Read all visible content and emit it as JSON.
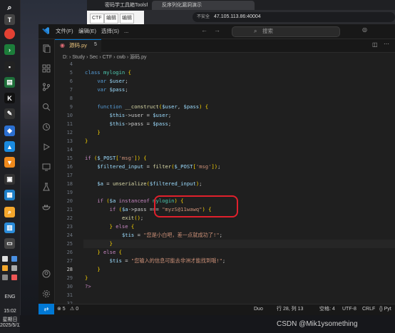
{
  "browser": {
    "tab1": "密码学工具箱Toolsfx",
    "tab2": "反序列化漏洞演示",
    "insecure_label": "不安全",
    "url": "47.105.113.86:40004",
    "bookmarks": [
      "CTF",
      "编辑",
      "编辑"
    ]
  },
  "vscode": {
    "menu": [
      "文件(F)",
      "编辑(E)",
      "选择(S)",
      "..."
    ],
    "search_placeholder": "搜索",
    "tab_label": "源码.py",
    "tab_dirty": "5",
    "breadcrumb": "D: › Study › Sec › CTF › cwb › 源码.py",
    "status": {
      "errors": "⊗ 5",
      "warnings": "⚠ 0",
      "duo": "Duo",
      "position": "行 28, 列 13",
      "spaces": "空格: 4",
      "encoding": "UTF-8",
      "eol": "CRLF",
      "lang": "{} Pyt"
    }
  },
  "code": {
    "line_numbers": [
      "4",
      "5",
      "6",
      "7",
      "8",
      "9",
      "10",
      "11",
      "12",
      "13",
      "14",
      "15",
      "16",
      "17",
      "18",
      "19",
      "20",
      "21",
      "22",
      "23",
      "24",
      "25",
      "26",
      "27",
      "28",
      "29",
      "30",
      "31",
      "32",
      "33"
    ],
    "lines": [
      "",
      "class mylogin {",
      "    var $user;",
      "    var $pass;",
      "",
      "    function __construct($user, $pass) {",
      "        $this->user = $user;",
      "        $this->pass = $pass;",
      "    }",
      "}",
      "",
      "if ($_POST['msg']) {",
      "    $filtered_input = filter($_POST['msg']);",
      "",
      "    $a = unserialize($filtered_input);",
      "",
      "    if ($a instanceof mylogin) {",
      "        if ($a->pass === \"myzS@11wawq\") {",
      "            exit();",
      "        } else {",
      "            $tis = \"您是小白吧，差一点就成功了!\";",
      "        }",
      "    } else {",
      "        $tis = \"您输入的信息可能去非洲才能找到哦!\";",
      "    }",
      "}",
      "?>",
      "",
      "",
      ""
    ]
  },
  "taskbar": {
    "lang": "ENG",
    "time": "15:02",
    "weekday": "星期日",
    "date": "2025/5/11"
  },
  "watermark": "CSDN @Mik1ysomething"
}
